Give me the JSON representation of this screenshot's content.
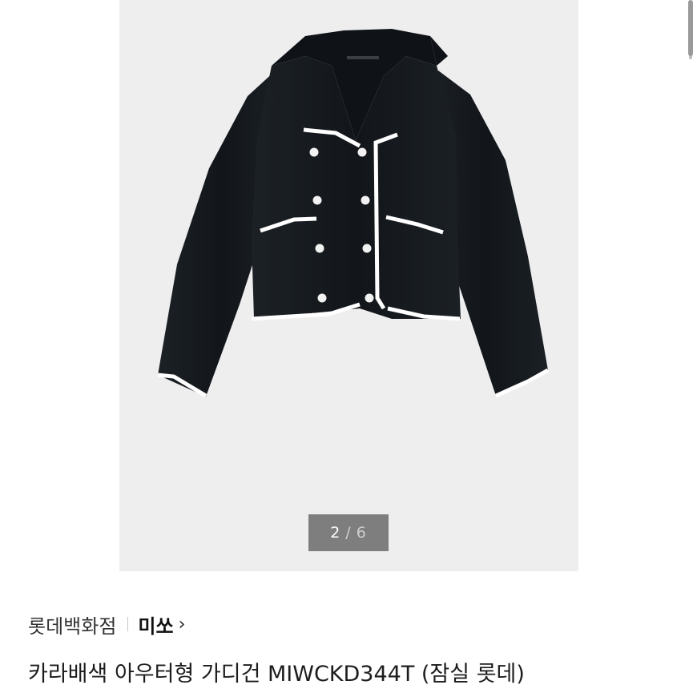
{
  "gallery": {
    "current": "2",
    "separator": "/",
    "total": "6",
    "image_alt": "black cropped double-breasted cardigan jacket with white trim"
  },
  "product": {
    "store": "롯데백화점",
    "brand": "미쏘",
    "title": "카라배색 아우터형 가디건 MIWCKD344T (잠실 롯데)"
  },
  "icons": {
    "chevron": "chevron-right-icon"
  },
  "colors": {
    "garment": "#12161a",
    "trim": "#ffffff",
    "photo_bg": "#eeeeef"
  }
}
